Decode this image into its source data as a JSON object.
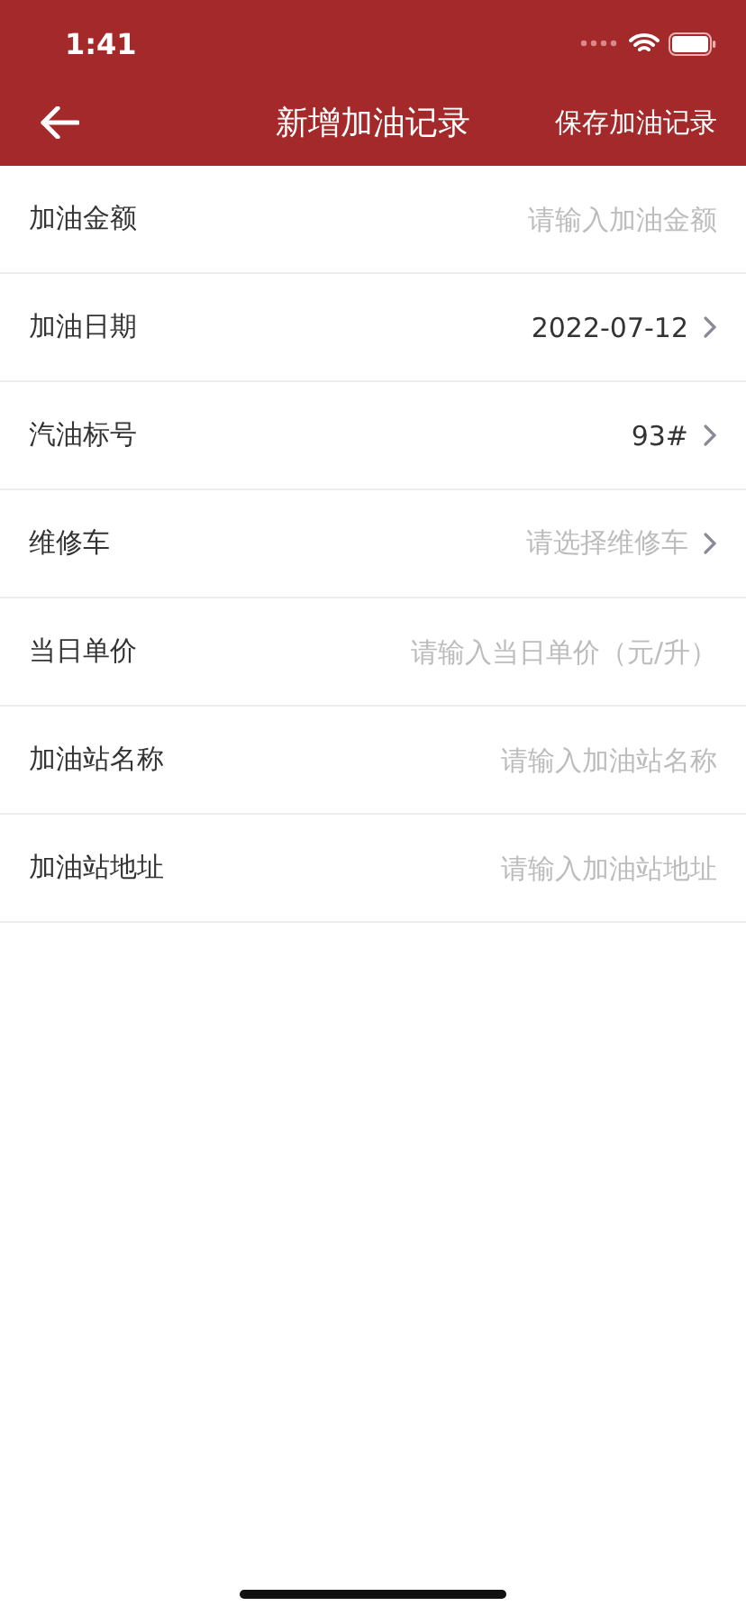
{
  "status_bar": {
    "time": "1:41"
  },
  "nav": {
    "title": "新增加油记录",
    "action": "保存加油记录"
  },
  "rows": [
    {
      "label": "加油金额",
      "kind": "input",
      "placeholder": "请输入加油金额"
    },
    {
      "label": "加油日期",
      "kind": "select",
      "value": "2022-07-12"
    },
    {
      "label": "汽油标号",
      "kind": "select",
      "value": "93#"
    },
    {
      "label": "维修车",
      "kind": "select",
      "placeholder": "请选择维修车"
    },
    {
      "label": "当日单价",
      "kind": "input",
      "placeholder": "请输入当日单价（元/升）"
    },
    {
      "label": "加油站名称",
      "kind": "input",
      "placeholder": "请输入加油站名称"
    },
    {
      "label": "加油站地址",
      "kind": "input",
      "placeholder": "请输入加油站地址"
    }
  ]
}
